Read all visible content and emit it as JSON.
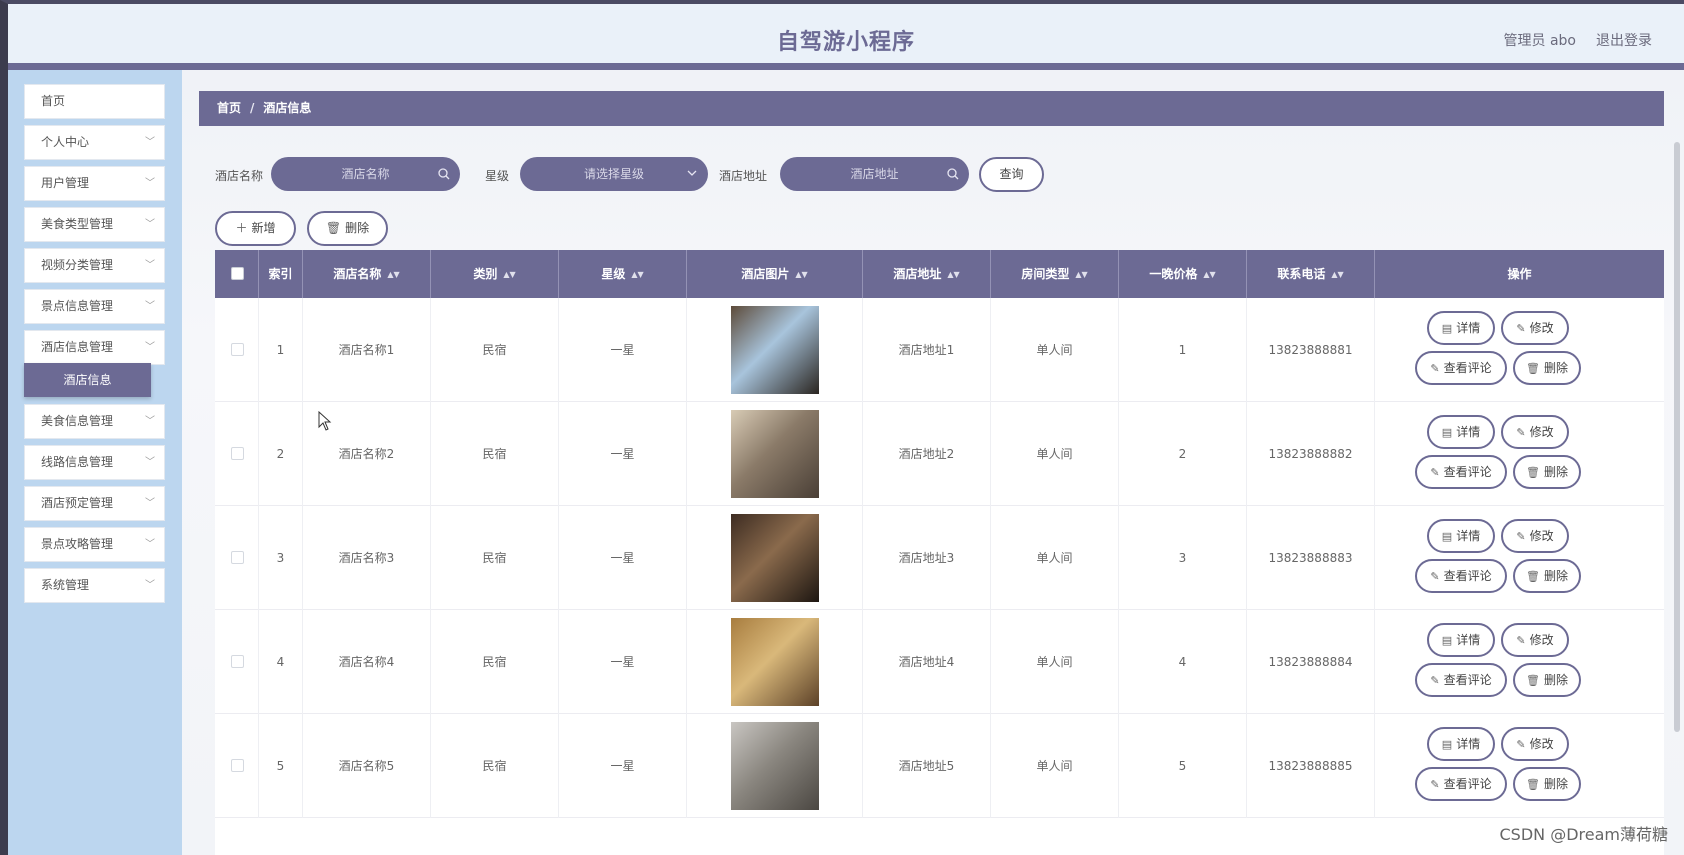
{
  "header": {
    "title": "自驾游小程序",
    "admin": "管理员 abo",
    "logout": "退出登录"
  },
  "sidebar": {
    "items": [
      {
        "label": "首页",
        "chevron": ""
      },
      {
        "label": "个人中心",
        "chevron": "﹀"
      },
      {
        "label": "用户管理",
        "chevron": "﹀"
      },
      {
        "label": "美食类型管理",
        "chevron": "﹀"
      },
      {
        "label": "视频分类管理",
        "chevron": "﹀"
      },
      {
        "label": "景点信息管理",
        "chevron": "﹀"
      },
      {
        "label": "酒店信息管理",
        "chevron": "﹀"
      },
      {
        "label": "美食信息管理",
        "chevron": "﹀"
      },
      {
        "label": "线路信息管理",
        "chevron": "﹀"
      },
      {
        "label": "酒店预定管理",
        "chevron": "﹀"
      },
      {
        "label": "景点攻略管理",
        "chevron": "﹀"
      },
      {
        "label": "系统管理",
        "chevron": "﹀"
      }
    ],
    "active_sub": "酒店信息"
  },
  "breadcrumb": {
    "home": "首页",
    "sep": "/",
    "current": "酒店信息"
  },
  "search": {
    "name_label": "酒店名称",
    "name_placeholder": "酒店名称",
    "star_label": "星级",
    "star_placeholder": "请选择星级",
    "addr_label": "酒店地址",
    "addr_placeholder": "酒店地址",
    "query_button": "查询"
  },
  "actions": {
    "add": "新增",
    "delete": "删除"
  },
  "table": {
    "columns": [
      "索引",
      "酒店名称",
      "类别",
      "星级",
      "酒店图片",
      "酒店地址",
      "房间类型",
      "一晚价格",
      "联系电话",
      "操作"
    ],
    "rows": [
      {
        "index": "1",
        "name": "酒店名称1",
        "category": "民宿",
        "star": "一星",
        "address": "酒店地址1",
        "room": "单人间",
        "price": "1",
        "phone": "13823888881"
      },
      {
        "index": "2",
        "name": "酒店名称2",
        "category": "民宿",
        "star": "一星",
        "address": "酒店地址2",
        "room": "单人间",
        "price": "2",
        "phone": "13823888882"
      },
      {
        "index": "3",
        "name": "酒店名称3",
        "category": "民宿",
        "star": "一星",
        "address": "酒店地址3",
        "room": "单人间",
        "price": "3",
        "phone": "13823888883"
      },
      {
        "index": "4",
        "name": "酒店名称4",
        "category": "民宿",
        "star": "一星",
        "address": "酒店地址4",
        "room": "单人间",
        "price": "4",
        "phone": "13823888884"
      },
      {
        "index": "5",
        "name": "酒店名称5",
        "category": "民宿",
        "star": "一星",
        "address": "酒店地址5",
        "room": "单人间",
        "price": "5",
        "phone": "13823888885"
      }
    ],
    "ops": {
      "detail": "详情",
      "edit": "修改",
      "comments": "查看评论",
      "delete": "删除"
    }
  },
  "icons": {
    "search": "search-icon",
    "chevron": "chevron-down-icon",
    "plus": "plus-icon",
    "trash": "trash-icon",
    "document": "document-icon",
    "pencil": "pencil-icon",
    "sort": "sort-icon"
  },
  "colors": {
    "accent": "#6c6a94",
    "sidebar": "#bcd6ef",
    "header": "#eaf1f9"
  },
  "watermark": "CSDN @Dream薄荷糖"
}
